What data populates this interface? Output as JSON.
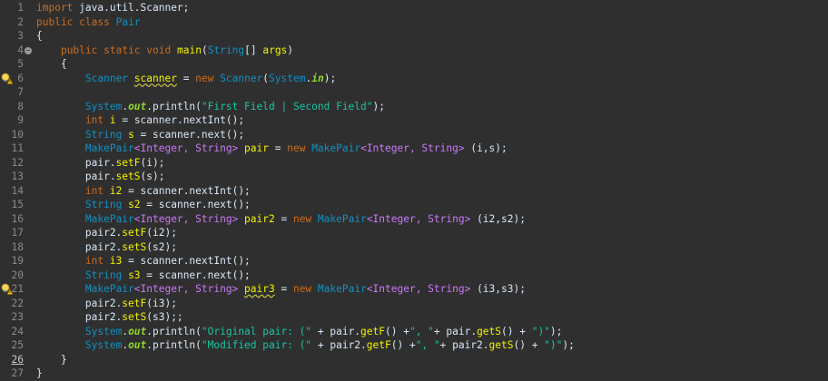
{
  "editor": {
    "lines": [
      {
        "num": "1",
        "segs": [
          [
            "kw",
            "import"
          ],
          [
            "p",
            " java.util.Scanner;"
          ]
        ]
      },
      {
        "num": "2",
        "segs": [
          [
            "kw",
            "public"
          ],
          [
            "p",
            " "
          ],
          [
            "kw",
            "class"
          ],
          [
            "p",
            " "
          ],
          [
            "ty",
            "Pair"
          ]
        ]
      },
      {
        "num": "3",
        "segs": [
          [
            "p",
            "{"
          ]
        ]
      },
      {
        "num": "4",
        "fold": true,
        "segs": [
          [
            "p",
            "    "
          ],
          [
            "kw",
            "public"
          ],
          [
            "p",
            " "
          ],
          [
            "kw",
            "static"
          ],
          [
            "p",
            " "
          ],
          [
            "kw",
            "void"
          ],
          [
            "p",
            " "
          ],
          [
            "ident",
            "main"
          ],
          [
            "p",
            "("
          ],
          [
            "ty",
            "String"
          ],
          [
            "p",
            "[] "
          ],
          [
            "ident",
            "args"
          ],
          [
            "p",
            ")"
          ]
        ]
      },
      {
        "num": "5",
        "segs": [
          [
            "p",
            "    {"
          ]
        ]
      },
      {
        "num": "6",
        "warn": true,
        "segs": [
          [
            "p",
            "        "
          ],
          [
            "ty",
            "Scanner"
          ],
          [
            "p",
            " "
          ],
          [
            "ident wavy",
            "scanner"
          ],
          [
            "p",
            " = "
          ],
          [
            "kw",
            "new"
          ],
          [
            "p",
            " "
          ],
          [
            "ty",
            "Scanner"
          ],
          [
            "p",
            "("
          ],
          [
            "ty",
            "System"
          ],
          [
            "p",
            "."
          ],
          [
            "fld",
            "in"
          ],
          [
            "p",
            ");"
          ]
        ]
      },
      {
        "num": "7",
        "segs": [
          [
            "p",
            ""
          ]
        ]
      },
      {
        "num": "8",
        "segs": [
          [
            "p",
            "        "
          ],
          [
            "ty",
            "System"
          ],
          [
            "p",
            "."
          ],
          [
            "fld",
            "out"
          ],
          [
            "p",
            ".println("
          ],
          [
            "str",
            "\"First Field | Second Field\""
          ],
          [
            "p",
            ");"
          ]
        ]
      },
      {
        "num": "9",
        "segs": [
          [
            "p",
            "        "
          ],
          [
            "kw",
            "int"
          ],
          [
            "p",
            " "
          ],
          [
            "ident",
            "i"
          ],
          [
            "p",
            " = scanner.nextInt();"
          ]
        ]
      },
      {
        "num": "10",
        "segs": [
          [
            "p",
            "        "
          ],
          [
            "ty",
            "String"
          ],
          [
            "p",
            " "
          ],
          [
            "ident",
            "s"
          ],
          [
            "p",
            " = scanner.next();"
          ]
        ]
      },
      {
        "num": "11",
        "segs": [
          [
            "p",
            "        "
          ],
          [
            "ty",
            "MakePair"
          ],
          [
            "gen",
            "<Integer, String>"
          ],
          [
            "p",
            " "
          ],
          [
            "ident",
            "pair"
          ],
          [
            "p",
            " = "
          ],
          [
            "kw",
            "new"
          ],
          [
            "p",
            " "
          ],
          [
            "ty",
            "MakePair"
          ],
          [
            "gen",
            "<Integer, String>"
          ],
          [
            "p",
            " (i,s);"
          ]
        ]
      },
      {
        "num": "12",
        "segs": [
          [
            "p",
            "        pair."
          ],
          [
            "ident",
            "setF"
          ],
          [
            "p",
            "(i);"
          ]
        ]
      },
      {
        "num": "13",
        "segs": [
          [
            "p",
            "        pair."
          ],
          [
            "ident",
            "setS"
          ],
          [
            "p",
            "(s);"
          ]
        ]
      },
      {
        "num": "14",
        "segs": [
          [
            "p",
            "        "
          ],
          [
            "kw",
            "int"
          ],
          [
            "p",
            " "
          ],
          [
            "ident",
            "i2"
          ],
          [
            "p",
            " = scanner.nextInt();"
          ]
        ]
      },
      {
        "num": "15",
        "segs": [
          [
            "p",
            "        "
          ],
          [
            "ty",
            "String"
          ],
          [
            "p",
            " "
          ],
          [
            "ident",
            "s2"
          ],
          [
            "p",
            " = scanner.next();"
          ]
        ]
      },
      {
        "num": "16",
        "segs": [
          [
            "p",
            "        "
          ],
          [
            "ty",
            "MakePair"
          ],
          [
            "gen",
            "<Integer, String>"
          ],
          [
            "p",
            " "
          ],
          [
            "ident",
            "pair2"
          ],
          [
            "p",
            " = "
          ],
          [
            "kw",
            "new"
          ],
          [
            "p",
            " "
          ],
          [
            "ty",
            "MakePair"
          ],
          [
            "gen",
            "<Integer, String>"
          ],
          [
            "p",
            " (i2,s2);"
          ]
        ]
      },
      {
        "num": "17",
        "segs": [
          [
            "p",
            "        pair2."
          ],
          [
            "ident",
            "setF"
          ],
          [
            "p",
            "(i2);"
          ]
        ]
      },
      {
        "num": "18",
        "segs": [
          [
            "p",
            "        pair2."
          ],
          [
            "ident",
            "setS"
          ],
          [
            "p",
            "(s2);"
          ]
        ]
      },
      {
        "num": "19",
        "segs": [
          [
            "p",
            "        "
          ],
          [
            "kw",
            "int"
          ],
          [
            "p",
            " "
          ],
          [
            "ident",
            "i3"
          ],
          [
            "p",
            " = scanner.nextInt();"
          ]
        ]
      },
      {
        "num": "20",
        "segs": [
          [
            "p",
            "        "
          ],
          [
            "ty",
            "String"
          ],
          [
            "p",
            " "
          ],
          [
            "ident",
            "s3"
          ],
          [
            "p",
            " = scanner.next();"
          ]
        ]
      },
      {
        "num": "21",
        "warn": true,
        "segs": [
          [
            "p",
            "        "
          ],
          [
            "ty",
            "MakePair"
          ],
          [
            "gen",
            "<Integer, String>"
          ],
          [
            "p",
            " "
          ],
          [
            "ident wavy",
            "pair3"
          ],
          [
            "p",
            " = "
          ],
          [
            "kw",
            "new"
          ],
          [
            "p",
            " "
          ],
          [
            "ty",
            "MakePair"
          ],
          [
            "gen",
            "<Integer, String>"
          ],
          [
            "p",
            " (i3,s3);"
          ]
        ]
      },
      {
        "num": "22",
        "segs": [
          [
            "p",
            "        pair2."
          ],
          [
            "ident",
            "setF"
          ],
          [
            "p",
            "(i3);"
          ]
        ]
      },
      {
        "num": "23",
        "segs": [
          [
            "p",
            "        pair2."
          ],
          [
            "ident",
            "setS"
          ],
          [
            "p",
            "(s3);;"
          ]
        ]
      },
      {
        "num": "24",
        "segs": [
          [
            "p",
            "        "
          ],
          [
            "ty",
            "System"
          ],
          [
            "p",
            "."
          ],
          [
            "fld",
            "out"
          ],
          [
            "p",
            ".println("
          ],
          [
            "str",
            "\"Original pair: (\""
          ],
          [
            "p",
            " + pair."
          ],
          [
            "ident",
            "getF"
          ],
          [
            "p",
            "() +"
          ],
          [
            "str",
            "\", \""
          ],
          [
            "p",
            "+ pair."
          ],
          [
            "ident",
            "getS"
          ],
          [
            "p",
            "() + "
          ],
          [
            "str",
            "\")\""
          ],
          [
            "p",
            ");"
          ]
        ]
      },
      {
        "num": "25",
        "segs": [
          [
            "p",
            "        "
          ],
          [
            "ty",
            "System"
          ],
          [
            "p",
            "."
          ],
          [
            "fld",
            "out"
          ],
          [
            "p",
            ".println("
          ],
          [
            "str",
            "\"Modified pair: (\""
          ],
          [
            "p",
            " + pair2."
          ],
          [
            "ident",
            "getF"
          ],
          [
            "p",
            "() +"
          ],
          [
            "str",
            "\", \""
          ],
          [
            "p",
            "+ pair2."
          ],
          [
            "ident",
            "getS"
          ],
          [
            "p",
            "() + "
          ],
          [
            "str",
            "\")\""
          ],
          [
            "p",
            ");"
          ]
        ]
      },
      {
        "num": "26",
        "current": true,
        "segs": [
          [
            "p",
            "    }"
          ]
        ]
      },
      {
        "num": "27",
        "segs": [
          [
            "p",
            "}"
          ]
        ]
      }
    ]
  },
  "colors": {
    "background": "#2f2f2f",
    "keyword": "#cc6c1d",
    "type": "#1290c3",
    "identifier": "#f2f200",
    "string": "#17c6a3",
    "generic": "#cc78fa",
    "field": "#8dda2d",
    "plain": "#d9e8f7"
  }
}
